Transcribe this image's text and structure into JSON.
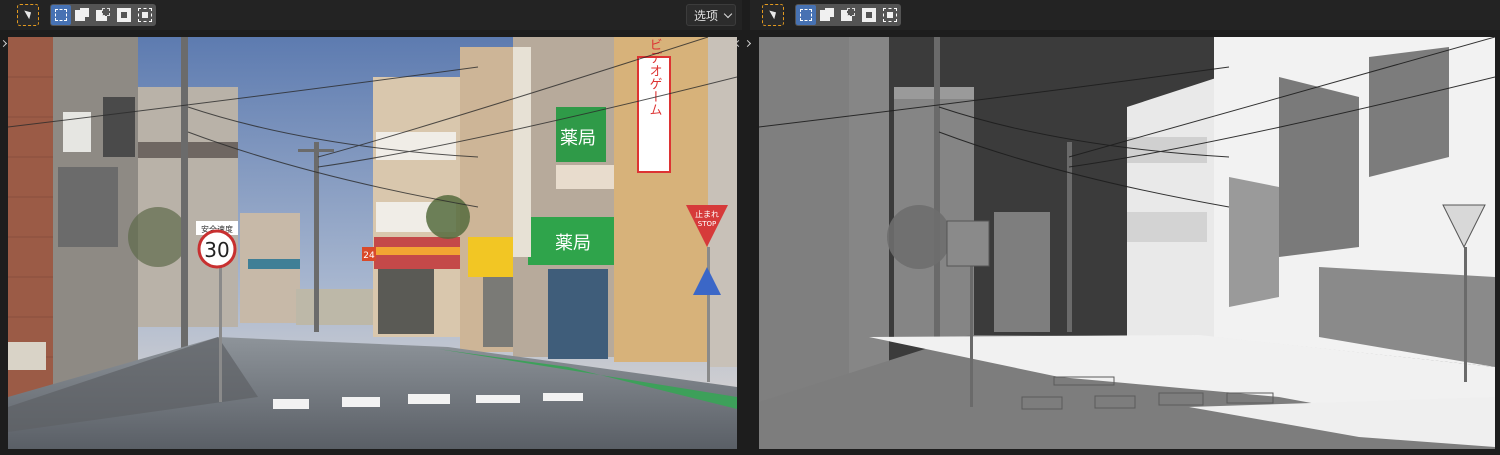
{
  "left_header": {
    "options_label": "选项",
    "tools": [
      "select-box-icon"
    ],
    "modes": [
      "new-selection",
      "extend-selection",
      "subtract-selection",
      "invert-selection",
      "intersect-selection"
    ],
    "active_mode": "new-selection"
  },
  "right_header": {
    "tools": [
      "select-box-icon"
    ],
    "modes": [
      "new-selection",
      "extend-selection",
      "subtract-selection",
      "invert-selection",
      "intersect-selection"
    ],
    "active_mode": "new-selection"
  },
  "signs": {
    "speed_limit_top": "安全速度",
    "speed_limit_value": "30",
    "pharmacy": "薬局",
    "game_sign": "ビデオゲーム",
    "stop_line1": "止まれ",
    "stop_line2": "STOP",
    "shop_number": "24"
  },
  "colors": {
    "accent_active": "#4772b3",
    "select_tool_border": "#e39a1f",
    "header_bg": "#232323"
  }
}
